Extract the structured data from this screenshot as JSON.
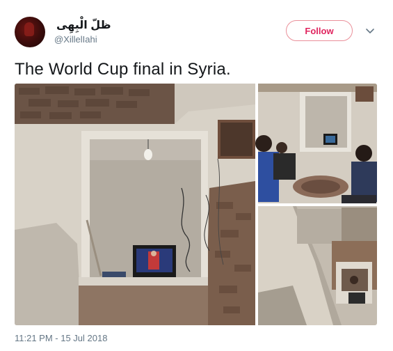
{
  "tweet": {
    "display_name": "ظلّ الْبِهِی",
    "handle": "@XillelIahi",
    "follow_label": "Follow",
    "more_icon": "chevron-down-icon",
    "text": "The World Cup final in Syria.",
    "timestamp": "11:21 PM - 15 Jul 2018"
  },
  "colors": {
    "follow_border": "#ea8f99",
    "follow_text": "#e0245e",
    "meta_text": "#657786",
    "body_text": "#14171a"
  }
}
